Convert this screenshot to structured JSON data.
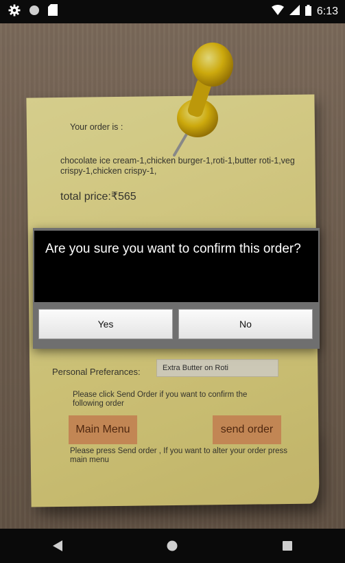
{
  "status_bar": {
    "time": "6:13",
    "icons": [
      "gear-icon",
      "circle-icon",
      "sd-card-icon",
      "wifi-icon",
      "signal-icon",
      "battery-icon"
    ]
  },
  "note": {
    "order_intro": "Your order is :",
    "order_items": "chocolate ice cream-1,chicken burger-1,roti-1,butter roti-1,veg crispy-1,chicken crispy-1,",
    "total_price": "total price:₹565",
    "preferences_label": "Personal Preferances:",
    "preferences_value": "Extra Butter on Roti",
    "instruction_confirm": "Please click Send Order if you want to confirm the following order",
    "main_menu_label": "Main Menu",
    "send_order_label": "send order",
    "instruction_alter": "Please press Send order , If you want to alter your order press main menu"
  },
  "dialog": {
    "title": "Are you sure you want to confirm this order?",
    "yes_label": "Yes",
    "no_label": "No"
  },
  "nav_bar": {
    "icons": [
      "back-icon",
      "home-icon",
      "recents-icon"
    ]
  },
  "colors": {
    "note": "#efe39a",
    "note_button": "#dd9960",
    "dialog_title_bg": "#000000",
    "wood": "#7f6c5b"
  }
}
